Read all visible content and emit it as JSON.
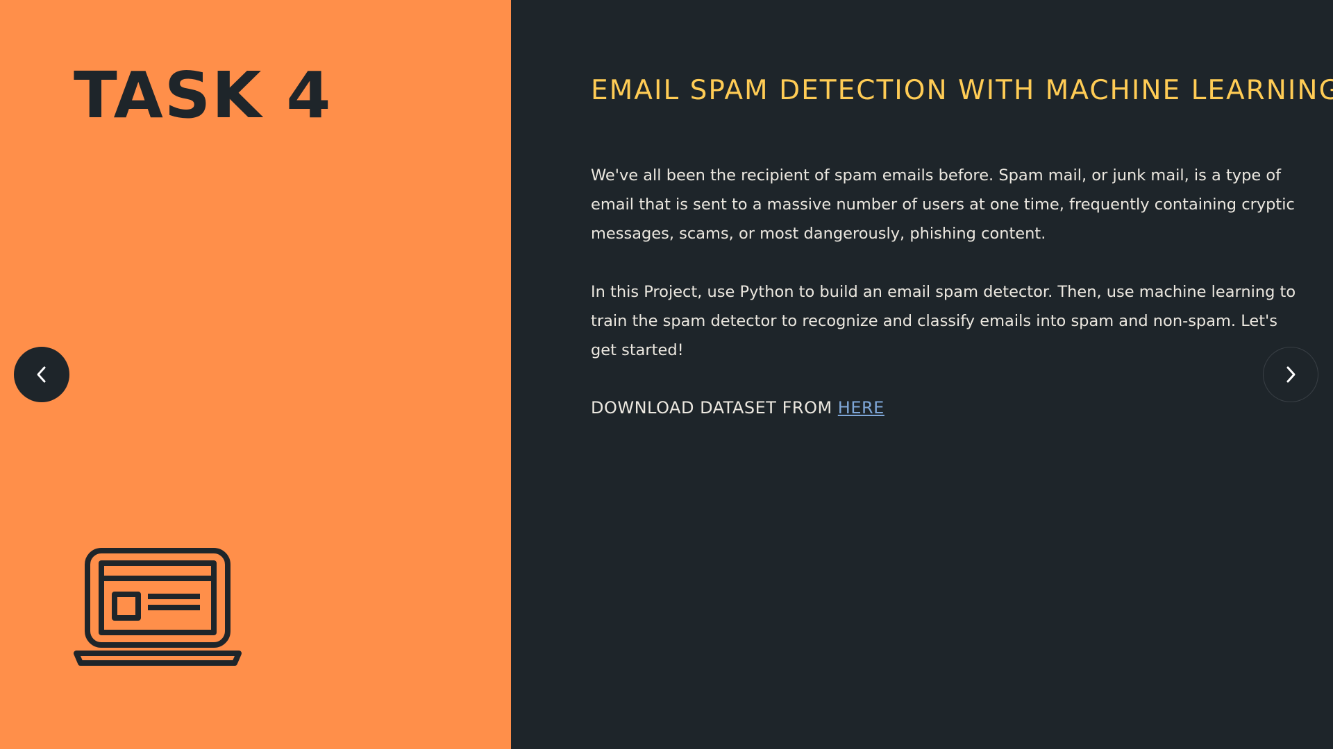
{
  "left": {
    "task_title": "TASK 4",
    "icon": "laptop-icon"
  },
  "right": {
    "title": "EMAIL SPAM DETECTION WITH MACHINE LEARNING",
    "paragraph1": "We've all been the recipient of spam emails before. Spam mail, or junk mail, is a type of email that is sent to a massive number of users at one time, frequently containing cryptic messages, scams, or most dangerously, phishing content.",
    "paragraph2": "In this Project, use Python to build an email spam detector. Then, use machine learning to train the spam detector to recognize and classify emails into spam and non-spam. Let's get started!",
    "download_prefix": "DOWNLOAD DATASET FROM ",
    "download_link": "HERE"
  },
  "navigation": {
    "prev_icon": "chevron-left-icon",
    "next_icon": "chevron-right-icon"
  },
  "colors": {
    "left_background": "#ff8f4a",
    "right_background": "#1e252a",
    "title_accent": "#ffcc55",
    "body_text": "#ece8e0",
    "link": "#7fa7d8"
  }
}
